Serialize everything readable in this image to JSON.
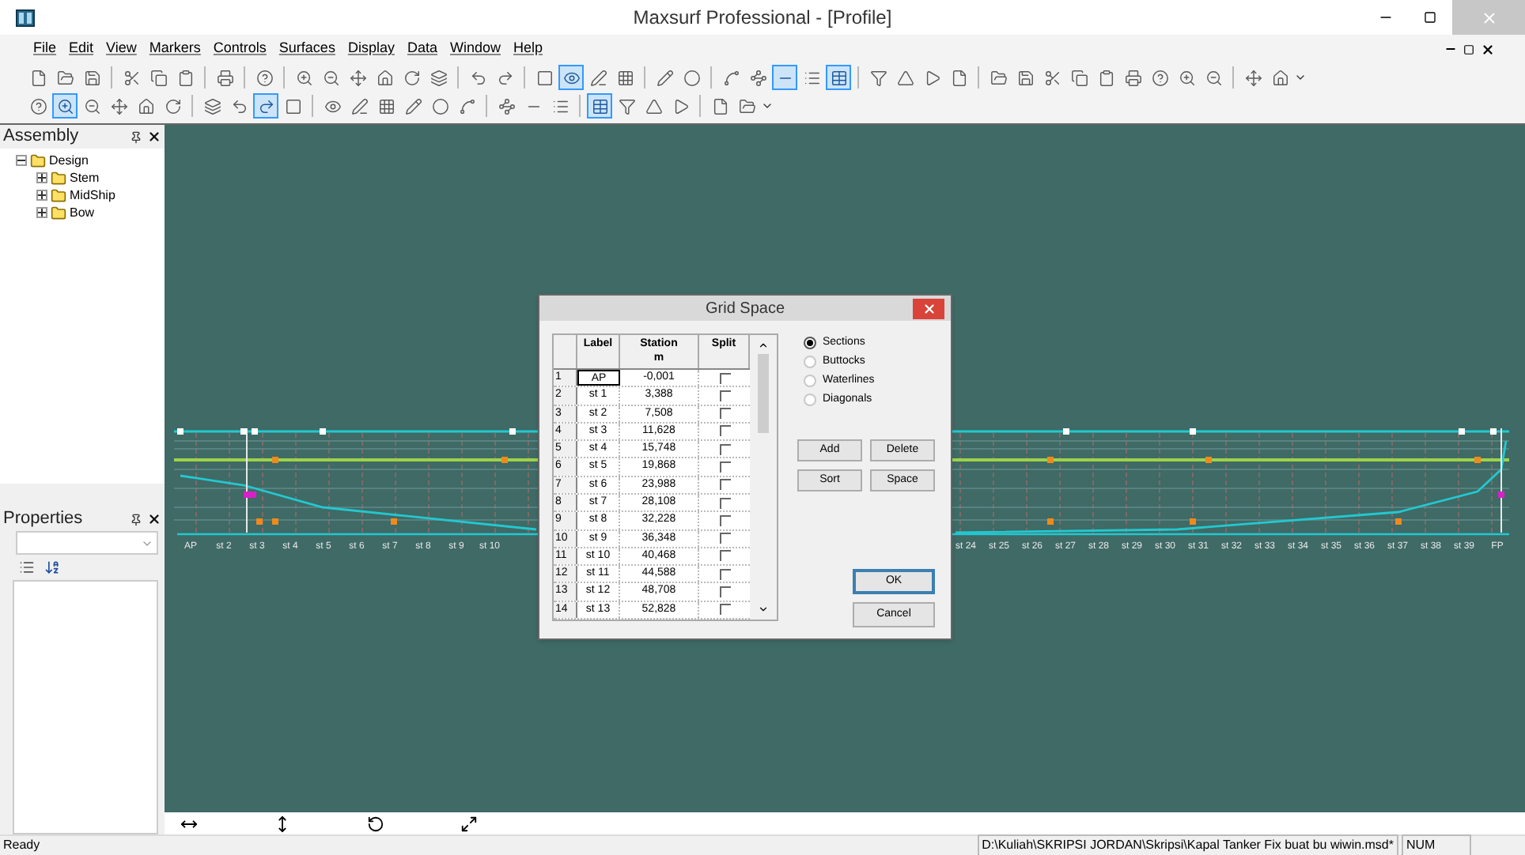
{
  "window": {
    "title": "Maxsurf Professional - [Profile]"
  },
  "menu": [
    "File",
    "Edit",
    "View",
    "Markers",
    "Controls",
    "Surfaces",
    "Display",
    "Data",
    "Window",
    "Help"
  ],
  "toolbars": [
    {
      "buttons": [
        {
          "selected": false
        },
        {
          "selected": false
        },
        {
          "selected": false
        },
        {
          "kind": "separator"
        },
        {
          "selected": false
        },
        {
          "selected": false
        },
        {
          "selected": false
        },
        {
          "kind": "separator"
        },
        {
          "selected": false
        },
        {
          "kind": "separator"
        },
        {
          "selected": false
        },
        {
          "kind": "separator"
        },
        {
          "selected": false
        },
        {
          "selected": false
        },
        {
          "selected": false
        },
        {
          "selected": false
        },
        {
          "selected": false
        },
        {
          "selected": false
        },
        {
          "kind": "separator"
        },
        {
          "selected": false
        },
        {
          "selected": false
        },
        {
          "kind": "separator"
        },
        {
          "selected": false
        },
        {
          "selected": true
        },
        {
          "selected": false
        },
        {
          "selected": false
        },
        {
          "kind": "separator"
        },
        {
          "selected": false
        },
        {
          "selected": false
        },
        {
          "kind": "separator"
        },
        {
          "selected": false
        },
        {
          "selected": false
        },
        {
          "selected": true
        },
        {
          "selected": false
        },
        {
          "selected": true
        },
        {
          "kind": "separator"
        },
        {
          "selected": false
        },
        {
          "selected": false
        },
        {
          "selected": false
        },
        {
          "selected": false
        },
        {
          "kind": "separator"
        },
        {
          "selected": false
        },
        {
          "selected": false
        },
        {
          "selected": false
        },
        {
          "selected": false
        },
        {
          "selected": false
        },
        {
          "selected": false
        },
        {
          "selected": false
        },
        {
          "selected": false
        },
        {
          "selected": false
        },
        {
          "kind": "separator"
        },
        {
          "selected": false
        },
        {
          "selected": false
        }
      ]
    },
    {
      "buttons": [
        {
          "selected": false
        },
        {
          "selected": true
        },
        {
          "selected": false
        },
        {
          "selected": false
        },
        {
          "selected": false
        },
        {
          "selected": false
        },
        {
          "kind": "separator"
        },
        {
          "selected": false
        },
        {
          "selected": false
        },
        {
          "selected": true
        },
        {
          "selected": false
        },
        {
          "kind": "separator"
        },
        {
          "selected": false
        },
        {
          "selected": false
        },
        {
          "selected": false
        },
        {
          "selected": false
        },
        {
          "selected": false
        },
        {
          "selected": false
        },
        {
          "kind": "separator"
        },
        {
          "selected": false
        },
        {
          "selected": false
        },
        {
          "selected": false
        },
        {
          "kind": "separator"
        },
        {
          "selected": true
        },
        {
          "selected": false
        },
        {
          "selected": false
        },
        {
          "selected": false
        },
        {
          "kind": "separator"
        },
        {
          "selected": false
        },
        {
          "selected": false
        }
      ]
    }
  ],
  "assembly": {
    "title": "Assembly",
    "tree": [
      {
        "label": "Design",
        "expanded": true,
        "children": [
          {
            "label": "Stem",
            "expanded": false
          },
          {
            "label": "MidShip",
            "expanded": false
          },
          {
            "label": "Bow",
            "expanded": false
          }
        ]
      }
    ]
  },
  "properties": {
    "title": "Properties"
  },
  "stations_left": [
    "AP",
    "st 2",
    "st 3",
    "st 4",
    "st 5",
    "st 6",
    "st 7",
    "st 8",
    "st 9",
    "st 10"
  ],
  "stations_right": [
    "st 24",
    "st 25",
    "st 26",
    "st 27",
    "st 28",
    "st 29",
    "st 30",
    "st 31",
    "st 32",
    "st 33",
    "st 34",
    "st 35",
    "st 36",
    "st 37",
    "st 38",
    "st 39",
    "FP"
  ],
  "dialog": {
    "title": "Grid Space",
    "columns": [
      {
        "label": "Label"
      },
      {
        "label": "Station",
        "unit": "m"
      },
      {
        "label": "Split"
      }
    ],
    "rows": [
      {
        "num": "1",
        "label": "AP",
        "station": "-0,001",
        "split": false,
        "selected": true
      },
      {
        "num": "2",
        "label": "st 1",
        "station": "3,388",
        "split": false,
        "selected": false
      },
      {
        "num": "3",
        "label": "st 2",
        "station": "7,508",
        "split": false,
        "selected": false
      },
      {
        "num": "4",
        "label": "st 3",
        "station": "11,628",
        "split": false,
        "selected": false
      },
      {
        "num": "5",
        "label": "st 4",
        "station": "15,748",
        "split": false,
        "selected": false
      },
      {
        "num": "6",
        "label": "st 5",
        "station": "19,868",
        "split": false,
        "selected": false
      },
      {
        "num": "7",
        "label": "st 6",
        "station": "23,988",
        "split": false,
        "selected": false
      },
      {
        "num": "8",
        "label": "st 7",
        "station": "28,108",
        "split": false,
        "selected": false
      },
      {
        "num": "9",
        "label": "st 8",
        "station": "32,228",
        "split": false,
        "selected": false
      },
      {
        "num": "10",
        "label": "st 9",
        "station": "36,348",
        "split": false,
        "selected": false
      },
      {
        "num": "11",
        "label": "st 10",
        "station": "40,468",
        "split": false,
        "selected": false
      },
      {
        "num": "12",
        "label": "st 11",
        "station": "44,588",
        "split": false,
        "selected": false
      },
      {
        "num": "13",
        "label": "st 12",
        "station": "48,708",
        "split": false,
        "selected": false
      },
      {
        "num": "14",
        "label": "st 13",
        "station": "52,828",
        "split": false,
        "selected": false
      }
    ],
    "options": [
      {
        "label": "Sections",
        "selected": true
      },
      {
        "label": "Buttocks",
        "selected": false
      },
      {
        "label": "Waterlines",
        "selected": false
      },
      {
        "label": "Diagonals",
        "selected": false
      }
    ],
    "buttons": [
      "Add",
      "Delete",
      "Sort",
      "Space"
    ],
    "ok": "OK",
    "cancel": "Cancel"
  },
  "status_bar": {
    "text": "Ready",
    "path": "D:\\Kuliah\\SKRIPSI JORDAN\\Skripsi\\Kapal Tanker Fix buat bu wiwin.msd*",
    "mode": "NUM"
  }
}
